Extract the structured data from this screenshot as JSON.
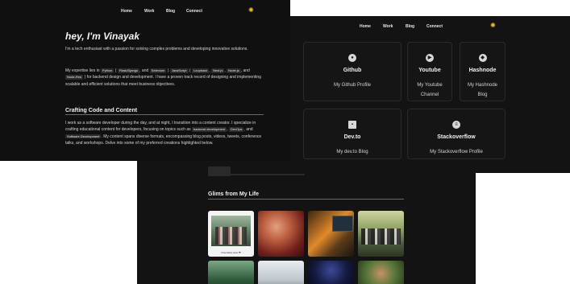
{
  "window2": {
    "photo_caption": "Friendship lasts ❤"
  },
  "window3": {
    "nav": [
      "Home",
      "Work",
      "Blog",
      "Connect"
    ],
    "theme_icon": "sun-icon",
    "cards": [
      {
        "title": "Github",
        "desc": "My Github Profile",
        "icon": "github-icon"
      },
      {
        "title": "Youtube",
        "desc": "My Youtube Channel",
        "icon": "youtube-icon"
      },
      {
        "title": "Hashnode",
        "desc": "My Hashnode Blog",
        "icon": "hashnode-icon"
      },
      {
        "title": "Dev.to",
        "desc": "My dev.to Blog",
        "icon": "devto-icon"
      },
      {
        "title": "Stackoverflow",
        "desc": "My Stackoverflow Profile",
        "icon": "stackoverflow-icon"
      }
    ],
    "glims_title": "Glims from My Life"
  },
  "window1": {
    "nav": [
      "Home",
      "Work",
      "Blog",
      "Connect"
    ],
    "theme_icon": "sun-icon",
    "greeting": "hey, I'm Vinayak",
    "intro": "I'm a tech enthusiast with a passion for solving complex problems and developing innovative solutions.",
    "expertise": {
      "t1": "My expertise lies in",
      "python": "Python",
      "t2": "(",
      "flask": "Flask/Django",
      "t3": ", and",
      "selenium": "Selenium",
      "t4": ")",
      "javascript": "JavaScript",
      "t5": "(",
      "loopback": "Loopback",
      "t6": ",",
      "nestjs": "Nest.js",
      "t7": ",",
      "nodejs": "Node.js",
      "t8": ", and",
      "nodered": "Node-Red",
      "t9": ") for backend design and development. I have a proven track record of designing and implementing scalable and efficient solutions that meet business objectives."
    },
    "section_title": "Crafting Code and Content",
    "crafting": {
      "t1": "I work as a software developer during the day, and at night, I transition into a content creator. I specialize in crafting educational content for developers, focusing on topics such as",
      "chip1": "backend development",
      "t2": ",",
      "chip2": "DevOps",
      "t3": ", and",
      "chip3": "Software Development",
      "t4": ". My content spans diverse formats, encompassing blog posts, videos, tweets, conference talks, and workshops. Delve into some of my preferred creations highlighted below."
    }
  }
}
